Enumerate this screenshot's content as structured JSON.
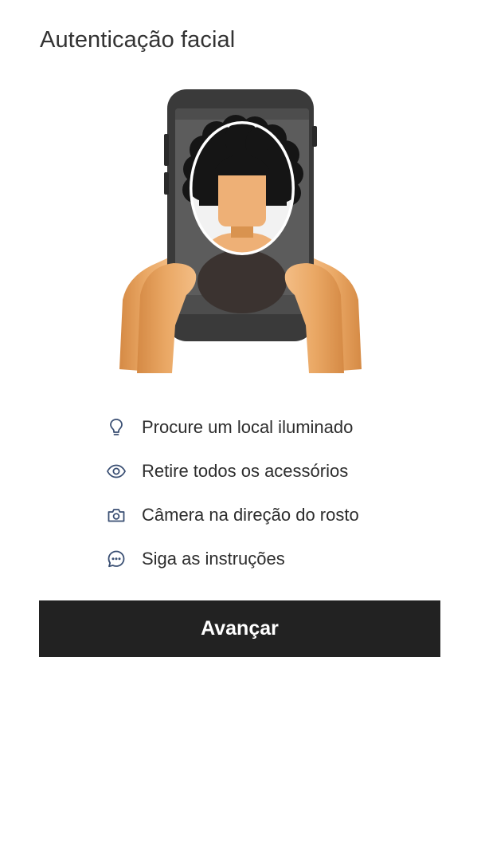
{
  "page": {
    "title": "Autenticação facial"
  },
  "illustration": {
    "icon": "phone-selfie-illustration"
  },
  "tips": [
    {
      "icon": "lightbulb-icon",
      "label": "Procure um local iluminado"
    },
    {
      "icon": "eye-icon",
      "label": "Retire todos os acessórios"
    },
    {
      "icon": "camera-icon",
      "label": "Câmera na direção do rosto"
    },
    {
      "icon": "chat-bubble-icon",
      "label": "Siga as instruções"
    }
  ],
  "actions": {
    "next_label": "Avançar"
  },
  "colors": {
    "icon": "#3a4f73",
    "button_bg": "#222222",
    "button_text": "#ffffff",
    "skin": "#e8a661",
    "phone": "#3a3a3a",
    "hair": "#1a1a1a"
  }
}
